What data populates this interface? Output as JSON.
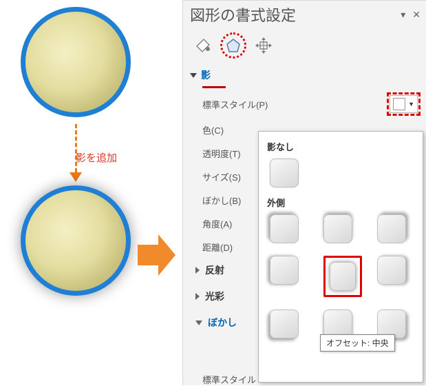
{
  "illustration": {
    "arrow_label": "影を追加"
  },
  "panel": {
    "title": "図形の書式設定",
    "tabs": {
      "fill": "fill-and-line",
      "effects": "effects",
      "size": "size-properties"
    },
    "shadow_section": {
      "title": "影",
      "fields": {
        "preset_label": "標準スタイル(P)",
        "color_label": "色(C)",
        "transparency_label": "透明度(T)",
        "size_label": "サイズ(S)",
        "blur_label": "ぼかし(B)",
        "angle_label": "角度(A)",
        "distance_label": "距離(D)"
      }
    },
    "sections": {
      "reflection": "反射",
      "glow": "光彩",
      "soft_edge": "ぼかし"
    },
    "bottom_cut": "標準スタイル"
  },
  "popup": {
    "no_shadow_label": "影なし",
    "outer_label": "外側",
    "tooltip": "オフセット: 中央"
  }
}
